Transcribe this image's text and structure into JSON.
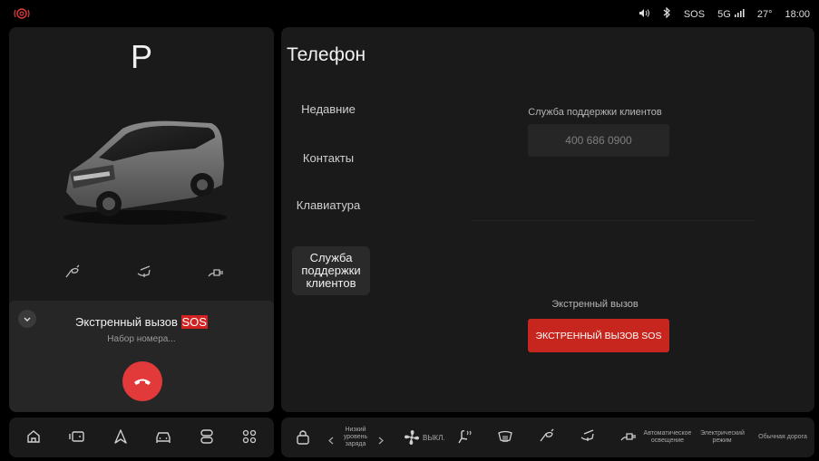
{
  "status": {
    "sound_icon": "volume-icon",
    "bluetooth_icon": "bluetooth-icon",
    "sos": "SOS",
    "network": "5G",
    "temperature": "27°",
    "time": "18:00"
  },
  "vehicle": {
    "gear": "P"
  },
  "call": {
    "title": "Экстренный вызов",
    "title_highlight": "SOS",
    "status": "Набор номера..."
  },
  "phone": {
    "title": "Телефон",
    "nav": [
      {
        "label": "Недавние"
      },
      {
        "label": "Контакты"
      },
      {
        "label": "Клавиатура"
      },
      {
        "label": "Служба поддержки клиентов"
      }
    ],
    "service_label": "Служба поддержки клиентов",
    "service_number": "400 686 0900",
    "emergency_label": "Экстренный вызов",
    "emergency_button": "ЭКСТРЕННЫЙ ВЫЗОВ SOS"
  },
  "dock": {
    "battery_label": "Низкий уровень заряда",
    "fan_label": "ВЫКЛ.",
    "lighting_label": "Автоматическое освещение",
    "mode_label": "Электрический режим",
    "road_label": "Обычная дорога"
  },
  "colors": {
    "accent_red": "#c7261f",
    "hangup_red": "#e23a3a",
    "panel_bg": "#1a1a1a"
  }
}
